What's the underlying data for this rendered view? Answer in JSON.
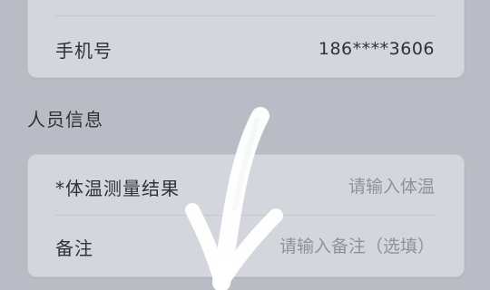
{
  "contact": {
    "phone_label": "手机号",
    "phone_value": "186****3606"
  },
  "personnel": {
    "section_title": "人员信息",
    "temperature_label": "*体温测量结果",
    "temperature_placeholder": "请输入体温",
    "remark_label": "备注",
    "remark_placeholder": "请输入备注（选填）"
  },
  "overlay": {
    "icon": "down-arrow-icon",
    "color": "#ffffff"
  }
}
